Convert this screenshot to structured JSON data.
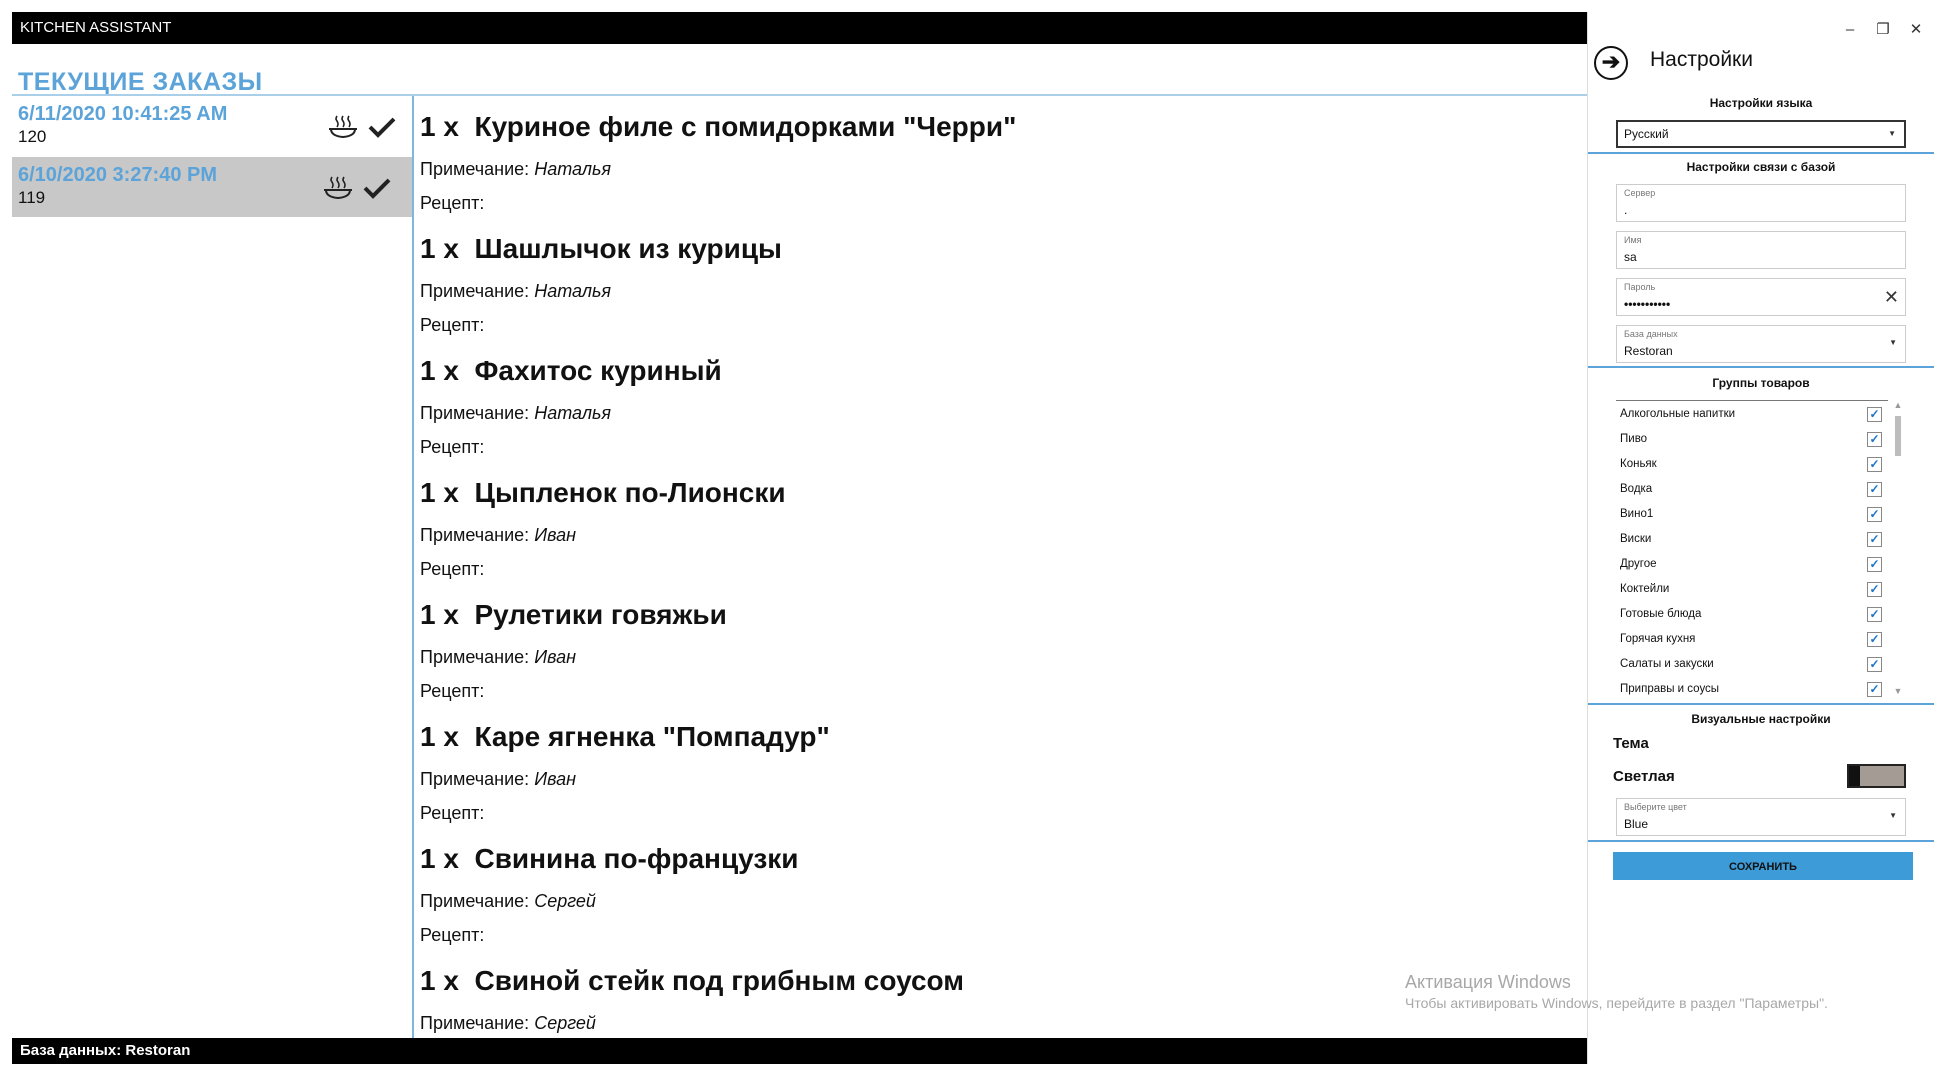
{
  "window": {
    "title": "KITCHEN ASSISTANT"
  },
  "header": {
    "title": "ТЕКУЩИЕ ЗАКАЗЫ"
  },
  "orders": [
    {
      "date": "6/11/2020 10:41:25 AM",
      "number": "120",
      "selected": false
    },
    {
      "date": "6/10/2020 3:27:40 PM",
      "number": "119",
      "selected": true
    }
  ],
  "order_items": [
    {
      "qty": "1 x",
      "name": "Куриное филе с помидорками \"Черри\"",
      "note_label": "Примечание:",
      "note": "Наталья",
      "recipe_label": "Рецепт:"
    },
    {
      "qty": "1 x",
      "name": "Шашлычок из курицы",
      "note_label": "Примечание:",
      "note": "Наталья",
      "recipe_label": "Рецепт:"
    },
    {
      "qty": "1 x",
      "name": "Фахитос куриный",
      "note_label": "Примечание:",
      "note": "Наталья",
      "recipe_label": "Рецепт:"
    },
    {
      "qty": "1 x",
      "name": "Цыпленок по-Лионски",
      "note_label": "Примечание:",
      "note": "Иван",
      "recipe_label": "Рецепт:"
    },
    {
      "qty": "1 x",
      "name": "Рулетики говяжьи",
      "note_label": "Примечание:",
      "note": "Иван",
      "recipe_label": "Рецепт:"
    },
    {
      "qty": "1 x",
      "name": "Каре ягненка \"Помпадур\"",
      "note_label": "Примечание:",
      "note": "Иван",
      "recipe_label": "Рецепт:"
    },
    {
      "qty": "1 x",
      "name": "Свинина по-французки",
      "note_label": "Примечание:",
      "note": "Сергей",
      "recipe_label": "Рецепт:"
    },
    {
      "qty": "1 x",
      "name": "Свиной стейк под грибным соусом",
      "note_label": "Примечание:",
      "note": "Сергей",
      "recipe_label": ""
    }
  ],
  "status": {
    "text": "База данных: Restoran"
  },
  "settings": {
    "title": "Настройки",
    "language_section": "Настройки языка",
    "language_value": "Русский",
    "db_section": "Настройки связи с базой",
    "server_label": "Сервер",
    "server_value": ".",
    "name_label": "Имя",
    "name_value": "sa",
    "password_label": "Пароль",
    "password_value": "•••••••••••",
    "database_label": "База данных",
    "database_value": "Restoran",
    "groups_section": "Группы товаров",
    "groups": [
      {
        "name": "Алкогольные напитки",
        "checked": true
      },
      {
        "name": "Пиво",
        "checked": true
      },
      {
        "name": "Коньяк",
        "checked": true
      },
      {
        "name": "Водка",
        "checked": true
      },
      {
        "name": "Вино1",
        "checked": true
      },
      {
        "name": "Виски",
        "checked": true
      },
      {
        "name": "Другое",
        "checked": true
      },
      {
        "name": "Коктейли",
        "checked": true
      },
      {
        "name": "Готовые блюда",
        "checked": true
      },
      {
        "name": "Горячая кухня",
        "checked": true
      },
      {
        "name": "Салаты и закуски",
        "checked": true
      },
      {
        "name": "Приправы и соусы",
        "checked": true
      }
    ],
    "visual_section": "Визуальные настройки",
    "theme_label": "Тема",
    "theme_value": "Светлая",
    "color_label": "Выберите цвет",
    "color_value": "Blue",
    "save_label": "СОХРАНИТЬ"
  },
  "watermark": {
    "line1": "Активация Windows",
    "line2": "Чтобы активировать Windows, перейдите в раздел \"Параметры\"."
  },
  "colors": {
    "accent": "#5ba3d9",
    "button": "#3d9bd8",
    "titlebar": "#000000",
    "selected_row": "#c8c8c8"
  }
}
